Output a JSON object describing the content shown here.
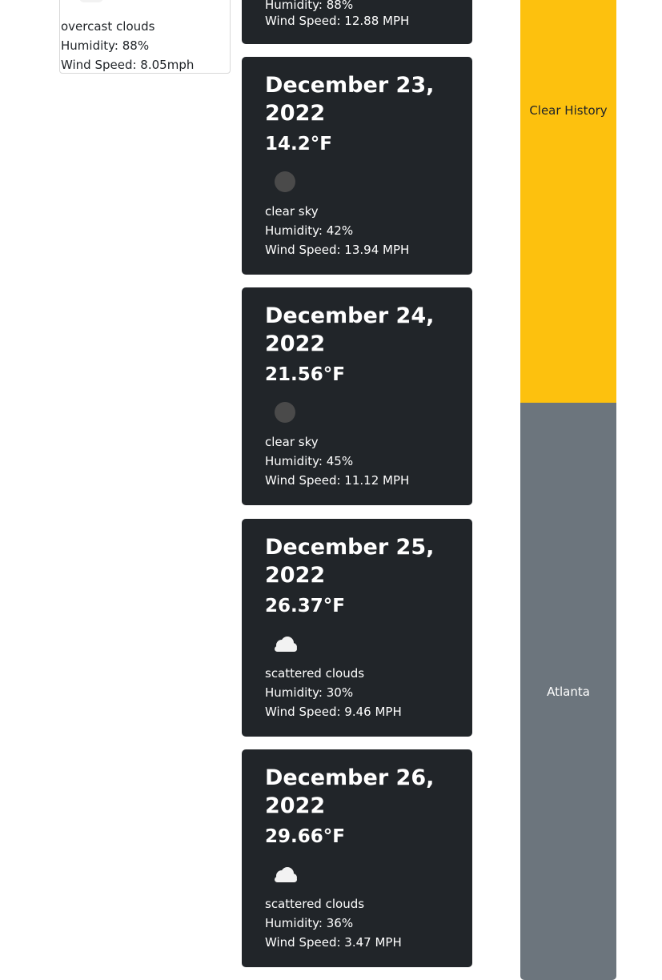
{
  "current": {
    "description": "overcast clouds",
    "humidity": "Humidity: 88%",
    "wind": "Wind Speed: 8.05mph"
  },
  "forecast_partial": {
    "humidity": "Humidity: 88%",
    "wind": "Wind Speed: 12.88 MPH"
  },
  "forecast": [
    {
      "date": "December 23, 2022",
      "temp": "14.2°F",
      "icon": "clear-sky-icon",
      "description": "clear sky",
      "humidity": "Humidity: 42%",
      "wind": "Wind Speed: 13.94 MPH"
    },
    {
      "date": "December 24, 2022",
      "temp": "21.56°F",
      "icon": "clear-sky-icon",
      "description": "clear sky",
      "humidity": "Humidity: 45%",
      "wind": "Wind Speed: 11.12 MPH"
    },
    {
      "date": "December 25, 2022",
      "temp": "26.37°F",
      "icon": "cloud-icon",
      "description": "scattered clouds",
      "humidity": "Humidity: 30%",
      "wind": "Wind Speed: 9.46 MPH"
    },
    {
      "date": "December 26, 2022",
      "temp": "29.66°F",
      "icon": "cloud-icon",
      "description": "scattered clouds",
      "humidity": "Humidity: 36%",
      "wind": "Wind Speed: 3.47 MPH"
    }
  ],
  "history": {
    "clear_label": "Clear History",
    "cities": [
      "Atlanta"
    ]
  },
  "colors": {
    "card_bg": "#212529",
    "clear_button": "#fdc10e",
    "city_button": "#6c757d"
  }
}
